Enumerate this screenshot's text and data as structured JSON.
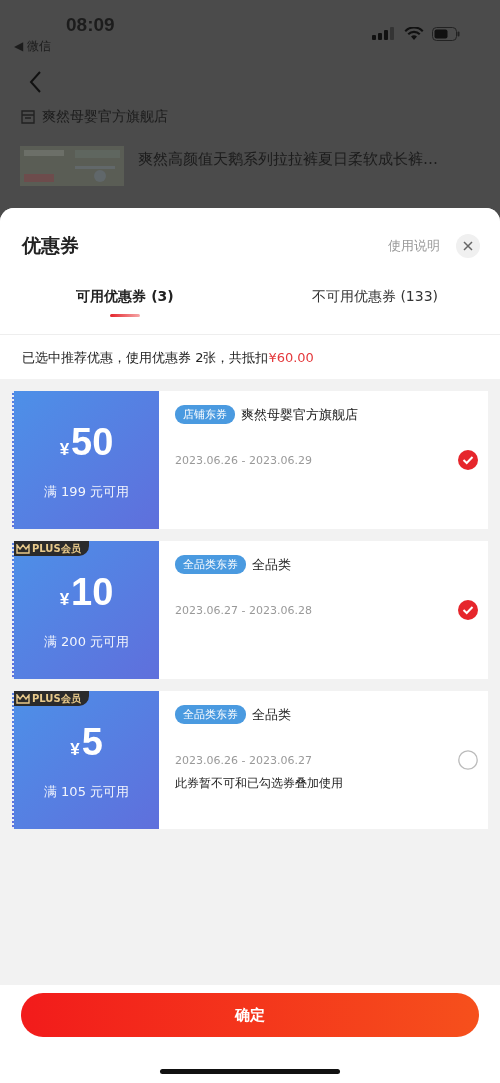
{
  "status_bar": {
    "time": "08:09",
    "back_app": "◀ 微信"
  },
  "background_page": {
    "store": "爽然母婴官方旗舰店",
    "product_title": "爽然高颜值天鹅系列拉拉裤夏日柔软成长裤…"
  },
  "sheet": {
    "title": "优惠券",
    "help_link": "使用说明",
    "tabs": [
      {
        "label": "可用优惠券 (3)",
        "selected": true
      },
      {
        "label": "不可用优惠券 (133)",
        "selected": false
      }
    ],
    "summary": {
      "text": "已选中推荐优惠，使用优惠券 2张，共抵扣",
      "amount": "¥60.00"
    },
    "coupons": [
      {
        "currency": "¥",
        "amount": "50",
        "condition": "满 199 元可用",
        "tag": "店铺东券",
        "scope": "爽然母婴官方旗舰店",
        "dates": "2023.06.26 - 2023.06.29",
        "selected": true
      },
      {
        "currency": "¥",
        "amount": "10",
        "condition": "满 200 元可用",
        "plus_badge": "PLUS会员",
        "tag": "全品类东券",
        "scope": "全品类",
        "dates": "2023.06.27 - 2023.06.28",
        "selected": true
      },
      {
        "currency": "¥",
        "amount": "5",
        "condition": "满 105 元可用",
        "plus_badge": "PLUS会员",
        "tag": "全品类东券",
        "scope": "全品类",
        "dates": "2023.06.26 - 2023.06.27",
        "note": "此券暂不可和已勾选券叠加使用",
        "selected": false
      }
    ],
    "confirm_button": "确定"
  }
}
